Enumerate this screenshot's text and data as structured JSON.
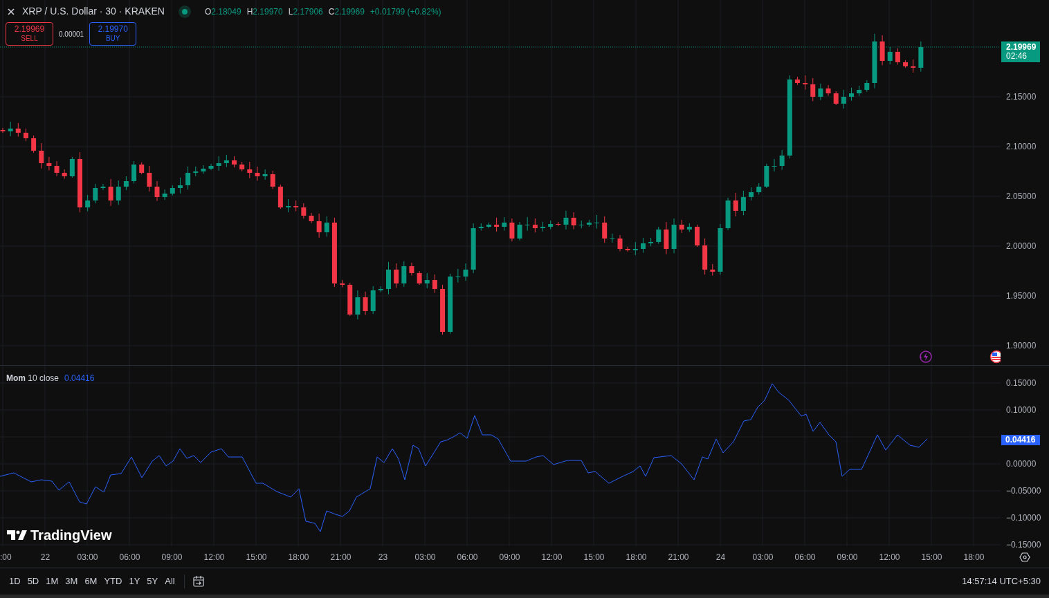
{
  "symbol": {
    "title": "XRP / U.S. Dollar · 30 · KRAKEN"
  },
  "ohlc": [
    {
      "label": "O",
      "value": "2.18049"
    },
    {
      "label": "H",
      "value": "2.19970"
    },
    {
      "label": "L",
      "value": "2.17906"
    },
    {
      "label": "C",
      "value": "2.19969"
    }
  ],
  "change": "+0.01799 (+0.82%)",
  "trade": {
    "sell": {
      "price": "2.19969",
      "label": "SELL"
    },
    "spread": "0.00001",
    "buy": {
      "price": "2.19970",
      "label": "BUY"
    }
  },
  "price_axis": {
    "ticks": [
      "2.15000",
      "2.10000",
      "2.05000",
      "2.00000",
      "1.95000",
      "1.90000"
    ],
    "last_price": "2.19969",
    "countdown": "02:46"
  },
  "indicator": {
    "name": "Mom",
    "params": "10 close",
    "value": "0.04416",
    "axis_value": "0.04416",
    "ticks": [
      "0.15000",
      "0.10000",
      "0.00000",
      "−0.05000",
      "−0.10000",
      "−0.15000"
    ]
  },
  "logo": "TradingView",
  "time_axis": {
    "ticks": [
      ":00",
      "22",
      "03:00",
      "06:00",
      "09:00",
      "12:00",
      "15:00",
      "18:00",
      "21:00",
      "23",
      "03:00",
      "06:00",
      "09:00",
      "12:00",
      "15:00",
      "18:00",
      "21:00",
      "24",
      "03:00",
      "06:00",
      "09:00",
      "12:00",
      "15:00",
      "18:00"
    ]
  },
  "ranges": [
    "1D",
    "5D",
    "1M",
    "3M",
    "6M",
    "YTD",
    "1Y",
    "5Y",
    "All"
  ],
  "clock": "14:57:14 UTC+5:30"
}
